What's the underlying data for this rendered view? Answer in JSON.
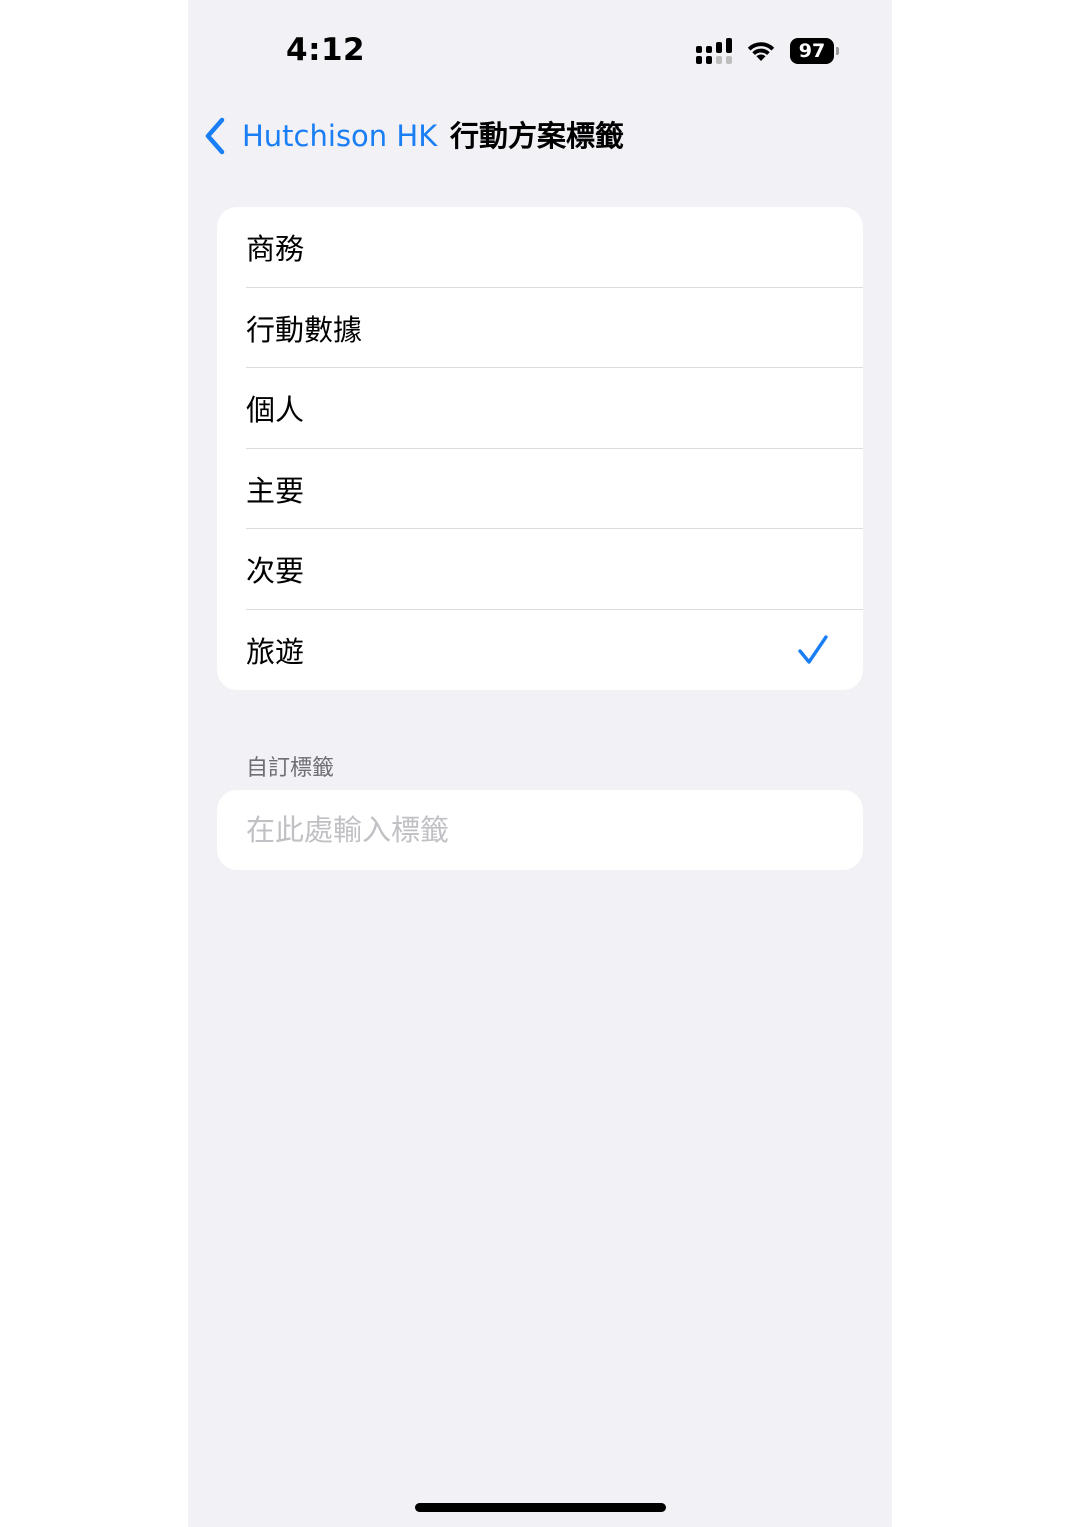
{
  "status_bar": {
    "time": "4:12",
    "battery": "97",
    "icons": [
      "cellular-signal-icon",
      "wifi-icon",
      "battery-icon"
    ]
  },
  "nav": {
    "back_label": "Hutchison HK",
    "title": "行動方案標籤"
  },
  "options": [
    {
      "label": "商務",
      "selected": false
    },
    {
      "label": "行動數據",
      "selected": false
    },
    {
      "label": "個人",
      "selected": false
    },
    {
      "label": "主要",
      "selected": false
    },
    {
      "label": "次要",
      "selected": false
    },
    {
      "label": "旅遊",
      "selected": true
    }
  ],
  "custom_label": {
    "header": "自訂標籤",
    "placeholder": "在此處輸入標籤",
    "value": ""
  },
  "colors": {
    "accent": "#1a7ef5",
    "background": "#f1f1f6",
    "card": "#ffffff",
    "separator": "#dcdce0",
    "placeholder": "#c0c0c5",
    "section_header": "#6e6e73"
  }
}
